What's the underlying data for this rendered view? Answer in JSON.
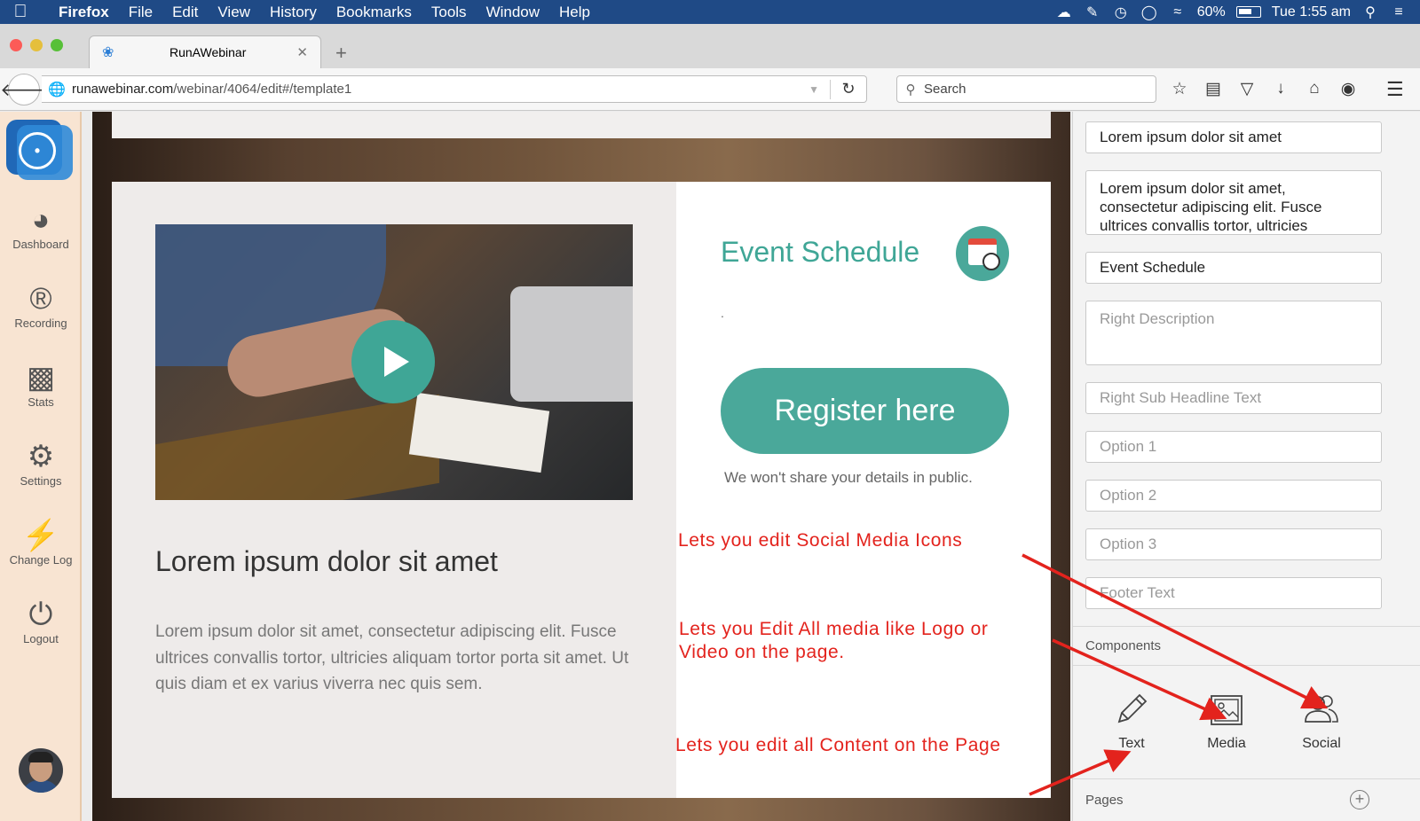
{
  "menubar": {
    "app": "Firefox",
    "items": [
      "File",
      "Edit",
      "View",
      "History",
      "Bookmarks",
      "Tools",
      "Window",
      "Help"
    ],
    "battery": "60%",
    "clock": "Tue 1:55 am"
  },
  "browser": {
    "tab_title": "RunAWebinar",
    "url_host": "runawebinar.com",
    "url_path": "/webinar/4064/edit#/template1",
    "search_placeholder": "Search"
  },
  "sidebar": {
    "items": [
      {
        "label": "Dashboard",
        "icon": "dashboard-icon"
      },
      {
        "label": "Recording",
        "icon": "recording-icon"
      },
      {
        "label": "Stats",
        "icon": "stats-icon"
      },
      {
        "label": "Settings",
        "icon": "gear-icon"
      },
      {
        "label": "Change Log",
        "icon": "lightning-icon"
      },
      {
        "label": "Logout",
        "icon": "power-icon"
      }
    ]
  },
  "canvas": {
    "headline": "Lorem ipsum dolor sit amet",
    "body": "Lorem ipsum dolor sit amet, consectetur adipiscing elit. Fusce ultrices convallis tortor, ultricies aliquam tortor porta sit amet. Ut quis diam et ex varius viverra nec quis sem.",
    "event_title": "Event Schedule",
    "dot": ".",
    "register_label": "Register here",
    "privacy_note": "We won't share your details in public.",
    "accent_color": "#4aa89a"
  },
  "annotations": {
    "social": "Lets you edit Social Media Icons",
    "media_line1": "Lets you Edit All media like Logo or",
    "media_line2": "Video on the page.",
    "text": "Lets you edit all Content on the Page",
    "color": "#e3231d"
  },
  "panel": {
    "field_headline": "Lorem ipsum dolor sit amet",
    "field_body": "Lorem ipsum dolor sit amet, consectetur adipiscing elit. Fusce ultrices convallis tortor, ultricies",
    "field_event": "Event Schedule",
    "ph_right_description": "Right Description",
    "ph_right_sub_headline": "Right Sub Headline Text",
    "ph_option1": "Option 1",
    "ph_option2": "Option 2",
    "ph_option3": "Option 3",
    "ph_footer": "Footer Text",
    "components_label": "Components",
    "components": [
      {
        "label": "Text",
        "icon": "pencil-icon"
      },
      {
        "label": "Media",
        "icon": "image-icon"
      },
      {
        "label": "Social",
        "icon": "users-icon"
      }
    ],
    "pages_label": "Pages"
  }
}
